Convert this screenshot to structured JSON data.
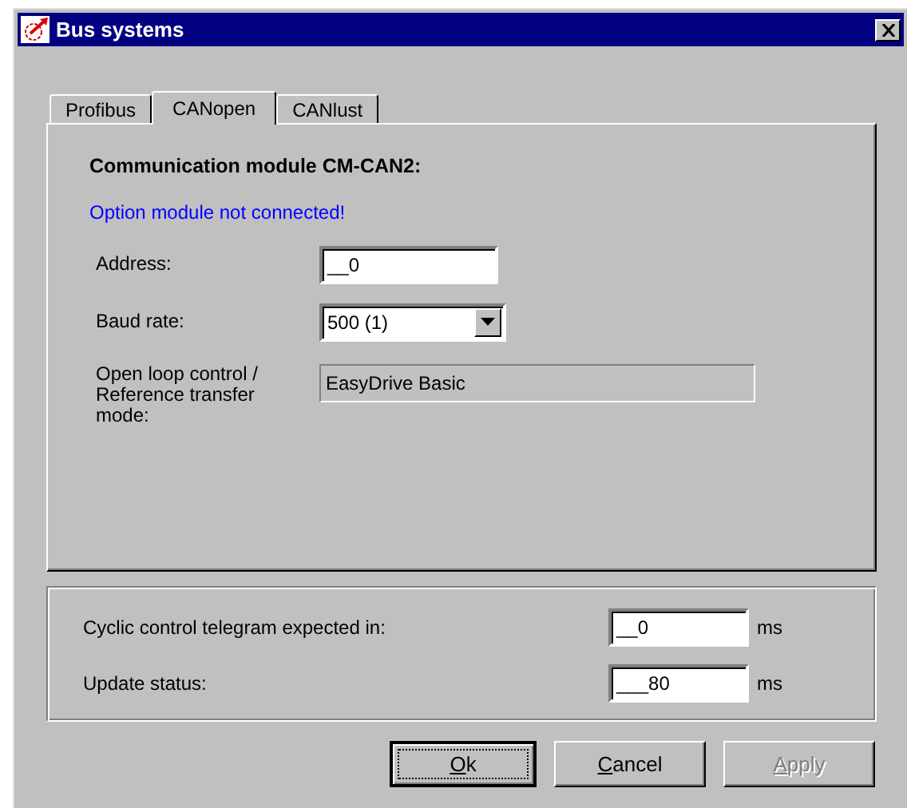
{
  "window": {
    "title": "Bus systems"
  },
  "tabs": [
    {
      "label": "Profibus",
      "selected": false
    },
    {
      "label": "CANopen",
      "selected": true
    },
    {
      "label": "CANlust",
      "selected": false
    }
  ],
  "panel": {
    "heading": "Communication module CM-CAN2:",
    "status": "Option module not connected!",
    "fields": [
      {
        "kind": "text",
        "label": "Address:",
        "value": "__0"
      },
      {
        "kind": "dropdown",
        "label": "Baud rate:",
        "value": "500 (1)"
      },
      {
        "kind": "readonly",
        "label": "Open loop control / Reference transfer mode:",
        "value": "EasyDrive Basic"
      }
    ]
  },
  "timing": [
    {
      "label": "Cyclic control telegram expected in:",
      "value": "__0",
      "unit": "ms"
    },
    {
      "label": "Update status:",
      "value": "___80",
      "unit": "ms"
    }
  ],
  "buttons": [
    {
      "label": "Ok",
      "default": true,
      "disabled": false
    },
    {
      "label": "Cancel",
      "default": false,
      "disabled": false
    },
    {
      "label": "Apply",
      "default": false,
      "disabled": true
    }
  ]
}
